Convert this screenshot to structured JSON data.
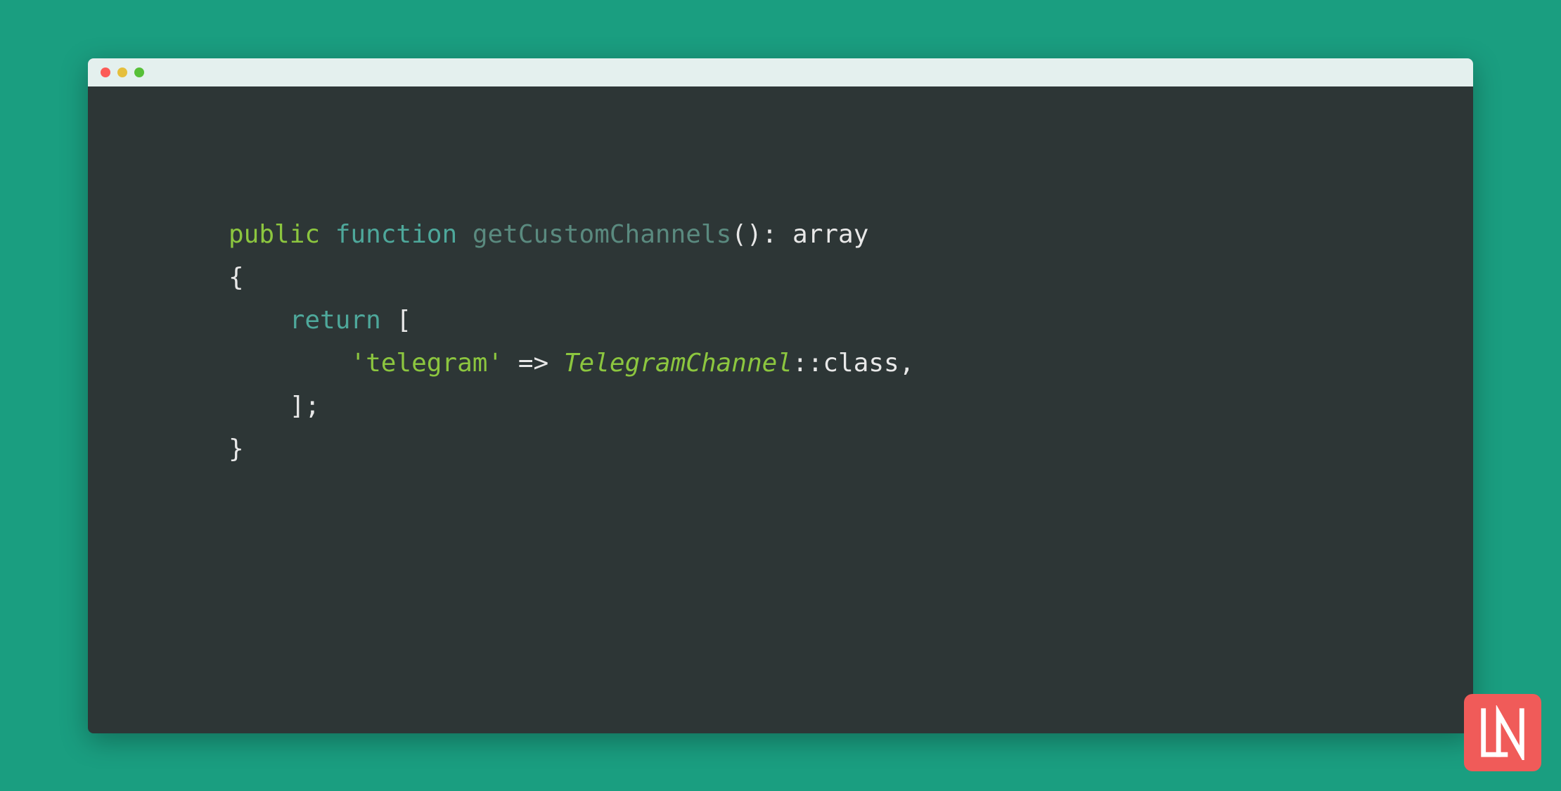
{
  "code": {
    "line1": {
      "public": "public",
      "function": "function",
      "method": "getCustomChannels",
      "parens": "()",
      "colon": ":",
      "type": "array"
    },
    "line2": {
      "brace_open": "{"
    },
    "line3": {
      "return": "return",
      "bracket_open": "["
    },
    "line4": {
      "string": "'telegram'",
      "arrow": "=>",
      "classname": "TelegramChannel",
      "scope": "::",
      "member": "class",
      "comma": ","
    },
    "line5": {
      "bracket_close": "]",
      "semicolon": ";"
    },
    "line6": {
      "brace_close": "}"
    }
  },
  "logo": {
    "letters": "LN"
  }
}
